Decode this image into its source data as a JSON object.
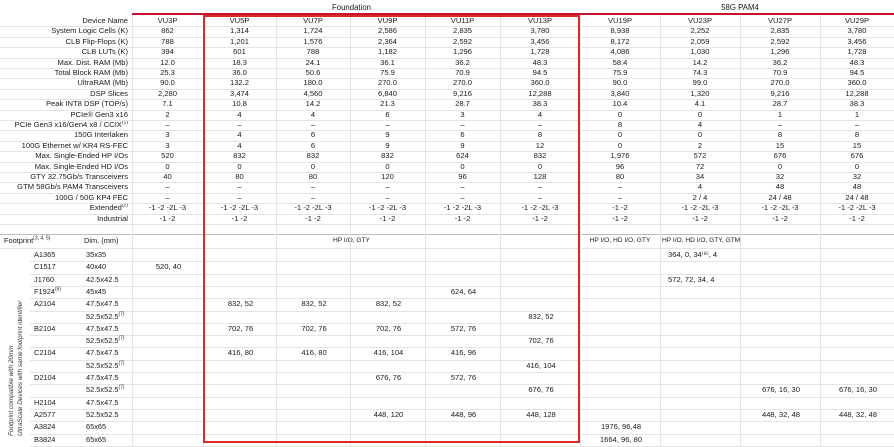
{
  "groups": {
    "foundation": "Foundation",
    "pam4": "58G PAM4"
  },
  "columns": [
    "VU3P",
    "VU5P",
    "VU7P",
    "VU9P",
    "VU11P",
    "VU13P",
    "VU19P",
    "VU23P",
    "VU27P",
    "VU29P"
  ],
  "device_name_label": "Device Name",
  "rows": [
    {
      "label": "System Logic Cells (K)",
      "values": [
        "862",
        "1,314",
        "1,724",
        "2,586",
        "2,835",
        "3,780",
        "8,938",
        "2,252",
        "2,835",
        "3,780"
      ]
    },
    {
      "label": "CLB Flip-Flops (K)",
      "values": [
        "788",
        "1,201",
        "1,576",
        "2,364",
        "2,592",
        "3,456",
        "8,172",
        "2,059",
        "2,592",
        "3,456"
      ]
    },
    {
      "label": "CLB LUTs (K)",
      "values": [
        "394",
        "601",
        "788",
        "1,182",
        "1,296",
        "1,728",
        "4,086",
        "1,030",
        "1,296",
        "1,728"
      ]
    },
    {
      "label": "Max. Dist. RAM (Mb)",
      "values": [
        "12.0",
        "18.3",
        "24.1",
        "36.1",
        "36.2",
        "48.3",
        "58.4",
        "14.2",
        "36.2",
        "48.3"
      ]
    },
    {
      "label": "Total Block RAM (Mb)",
      "values": [
        "25.3",
        "36.0",
        "50.6",
        "75.9",
        "70.9",
        "94.5",
        "75.9",
        "74.3",
        "70.9",
        "94.5"
      ]
    },
    {
      "label": "UltraRAM (Mb)",
      "values": [
        "90.0",
        "132.2",
        "180.0",
        "270.0",
        "270.0",
        "360.0",
        "90.0",
        "99.0",
        "270.0",
        "360.0"
      ]
    },
    {
      "label": "DSP Slices",
      "values": [
        "2,280",
        "3,474",
        "4,560",
        "6,840",
        "9,216",
        "12,288",
        "3,840",
        "1,320",
        "9,216",
        "12,288"
      ]
    },
    {
      "label": "Peak INT8 DSP (TOP/s)",
      "values": [
        "7.1",
        "10.8",
        "14.2",
        "21.3",
        "28.7",
        "38.3",
        "10.4",
        "4.1",
        "28.7",
        "38.3"
      ]
    },
    {
      "label": "PCIe® Gen3 x16",
      "values": [
        "2",
        "4",
        "4",
        "6",
        "3",
        "4",
        "0",
        "0",
        "1",
        "1"
      ]
    },
    {
      "label": "PCIe Gen3 x16/Gen4 x8 / CCIX",
      "sup": "(1)",
      "values": [
        "–",
        "–",
        "–",
        "–",
        "–",
        "–",
        "8",
        "4",
        "–",
        "–"
      ]
    },
    {
      "label": "150G Interlaken",
      "values": [
        "3",
        "4",
        "6",
        "9",
        "6",
        "8",
        "0",
        "0",
        "8",
        "8"
      ]
    },
    {
      "label": "100G Ethernet w/ KR4 RS-FEC",
      "values": [
        "3",
        "4",
        "6",
        "9",
        "9",
        "12",
        "0",
        "2",
        "15",
        "15"
      ]
    },
    {
      "label": "Max. Single-Ended HP I/Os",
      "values": [
        "520",
        "832",
        "832",
        "832",
        "624",
        "832",
        "1,976",
        "572",
        "676",
        "676"
      ]
    },
    {
      "label": "Max. Single-Ended HD I/Os",
      "values": [
        "0",
        "0",
        "0",
        "0",
        "0",
        "0",
        "96",
        "72",
        "0",
        "0"
      ]
    },
    {
      "label": "GTY 32.75Gb/s Transceivers",
      "values": [
        "40",
        "80",
        "80",
        "120",
        "96",
        "128",
        "80",
        "34",
        "32",
        "32"
      ]
    },
    {
      "label": "GTM 58Gb/s PAM4 Transceivers",
      "values": [
        "–",
        "–",
        "–",
        "–",
        "–",
        "–",
        "–",
        "4",
        "48",
        "48"
      ]
    },
    {
      "label": "100G / 50G KP4 FEC",
      "values": [
        "–",
        "–",
        "–",
        "–",
        "–",
        "–",
        "–",
        "2 / 4",
        "24 / 48",
        "24 / 48"
      ]
    },
    {
      "label": "Extended",
      "sup": "(2)",
      "values": [
        "-1 -2 -2L -3",
        "-1 -2 -2L -3",
        "-1 -2 -2L -3",
        "-1 -2 -2L -3",
        "-1 -2 -2L -3",
        "-1 -2 -2L -3",
        "-1 -2",
        "-1 -2 -2L -3",
        "-1 -2 -2L -3",
        "-1 -2 -2L -3"
      ]
    },
    {
      "label": "Industrial",
      "values": [
        "-1 -2",
        "-1 -2",
        "-1 -2",
        "-1 -2",
        "-1 -2",
        "-1 -2",
        "-1 -2",
        "-1 -2",
        "-1 -2",
        "-1 -2"
      ]
    }
  ],
  "footprint_header": {
    "label": "Footprint",
    "sup": "(3, 4, 5)",
    "dim": "Dim. (mm)",
    "hp_gty": "HP I/O, GTY",
    "hp_hd_gty": "HP I/O, HD I/O, GTY",
    "hp_hd_gty_gtm": "HP I/O, HD I/O, GTY, GTM"
  },
  "side_note": [
    "Footprint compatible with 20mm",
    "UltraScale Devices with same footprint identifier"
  ],
  "footprints": [
    {
      "name": "A1365",
      "dim": "35x35",
      "values": [
        "",
        "",
        "",
        "",
        "",
        "",
        "",
        "364, 0, 34⁽⁸⁾, 4",
        "",
        ""
      ]
    },
    {
      "name": "C1517",
      "dim": "40x40",
      "values": [
        "520, 40",
        "",
        "",
        "",
        "",
        "",
        "",
        "",
        "",
        ""
      ]
    },
    {
      "name": "J1760",
      "dim": "42.5x42.5",
      "values": [
        "",
        "",
        "",
        "",
        "",
        "",
        "",
        "572, 72, 34, 4",
        "",
        ""
      ]
    },
    {
      "name": "F1924",
      "sup": "(6)",
      "dim": "45x45",
      "values": [
        "",
        "",
        "",
        "",
        "624, 64",
        "",
        "",
        "",
        "",
        ""
      ]
    },
    {
      "name": "A2104",
      "dim": "47.5x47.5",
      "values": [
        "",
        "832, 52",
        "832, 52",
        "832, 52",
        "",
        "",
        "",
        "",
        "",
        ""
      ]
    },
    {
      "name": "",
      "dim": "52.5x52.5",
      "dimsup": "(7)",
      "values": [
        "",
        "",
        "",
        "",
        "",
        "832, 52",
        "",
        "",
        "",
        ""
      ]
    },
    {
      "name": "B2104",
      "dim": "47.5x47.5",
      "values": [
        "",
        "702, 76",
        "702, 76",
        "702, 76",
        "572, 76",
        "",
        "",
        "",
        "",
        ""
      ]
    },
    {
      "name": "",
      "dim": "52.5x52.5",
      "dimsup": "(7)",
      "values": [
        "",
        "",
        "",
        "",
        "",
        "702, 76",
        "",
        "",
        "",
        ""
      ]
    },
    {
      "name": "C2104",
      "dim": "47.5x47.5",
      "values": [
        "",
        "416, 80",
        "416, 80",
        "416, 104",
        "416, 96",
        "",
        "",
        "",
        "",
        ""
      ]
    },
    {
      "name": "",
      "dim": "52.5x52.5",
      "dimsup": "(7)",
      "values": [
        "",
        "",
        "",
        "",
        "",
        "416, 104",
        "",
        "",
        "",
        ""
      ]
    },
    {
      "name": "D2104",
      "dim": "47.5x47.5",
      "values": [
        "",
        "",
        "",
        "676, 76",
        "572, 76",
        "",
        "",
        "",
        "",
        ""
      ]
    },
    {
      "name": "",
      "dim": "52.5x52.5",
      "dimsup": "(7)",
      "values": [
        "",
        "",
        "",
        "",
        "",
        "676, 76",
        "",
        "",
        "676, 16, 30",
        "676, 16, 30"
      ]
    },
    {
      "name": "H2104",
      "dim": "47.5x47.5",
      "values": [
        "",
        "",
        "",
        "",
        "",
        "",
        "",
        "",
        "",
        ""
      ]
    },
    {
      "name": "A2577",
      "dim": "52.5x52.5",
      "values": [
        "",
        "",
        "",
        "448, 120",
        "448, 96",
        "448, 128",
        "",
        "",
        "448, 32, 48",
        "448, 32, 48"
      ]
    },
    {
      "name": "A3824",
      "dim": "65x65",
      "values": [
        "",
        "",
        "",
        "",
        "",
        "",
        "1976, 96,48",
        "",
        "",
        ""
      ]
    },
    {
      "name": "B3824",
      "dim": "65x65",
      "values": [
        "",
        "",
        "",
        "",
        "",
        "",
        "1664, 96, 80",
        "",
        "",
        ""
      ]
    }
  ],
  "colors": {
    "accent_red": "#c8102e",
    "highlight_box": "#e02828",
    "gridline": "#e4e4e4"
  }
}
